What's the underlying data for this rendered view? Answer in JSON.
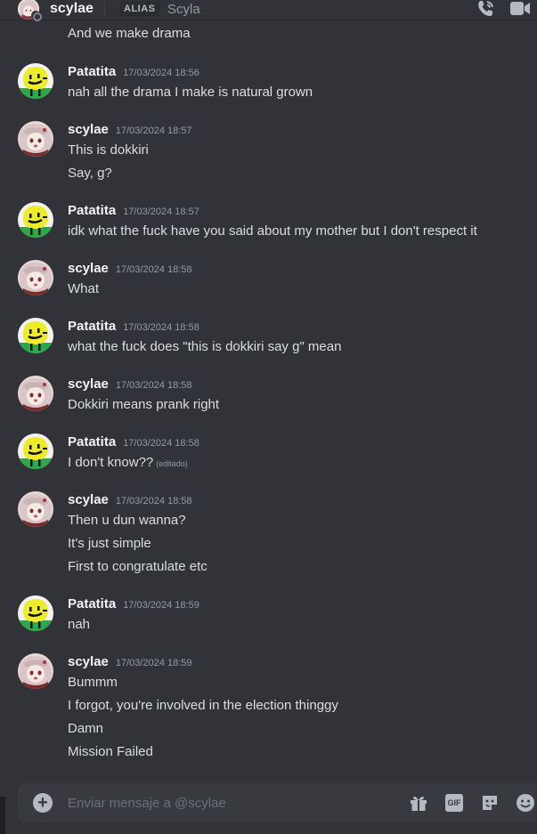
{
  "header": {
    "username": "scylae",
    "alias_badge": "ALIAS",
    "nickname": "Scyla"
  },
  "top_partial_message": "And we make drama",
  "groups": [
    {
      "author": "Patatita",
      "timestamp": "17/03/2024 18:56",
      "avatar": "patatita",
      "lines": [
        "nah all the drama I make is natural grown"
      ]
    },
    {
      "author": "scylae",
      "timestamp": "17/03/2024 18:57",
      "avatar": "scylae",
      "lines": [
        "This is dokkiri",
        "Say, g?"
      ]
    },
    {
      "author": "Patatita",
      "timestamp": "17/03/2024 18:57",
      "avatar": "patatita",
      "lines": [
        "idk what the fuck have you said about my mother but I don't respect it"
      ]
    },
    {
      "author": "scylae",
      "timestamp": "17/03/2024 18:58",
      "avatar": "scylae",
      "lines": [
        "What"
      ]
    },
    {
      "author": "Patatita",
      "timestamp": "17/03/2024 18:58",
      "avatar": "patatita",
      "lines": [
        "what the fuck does \"this is dokkiri say g\" mean"
      ]
    },
    {
      "author": "scylae",
      "timestamp": "17/03/2024 18:58",
      "avatar": "scylae",
      "lines": [
        "Dokkiri means prank right"
      ]
    },
    {
      "author": "Patatita",
      "timestamp": "17/03/2024 18:58",
      "avatar": "patatita",
      "lines": [
        "I don't know??"
      ],
      "edited_label": "(editado)"
    },
    {
      "author": "scylae",
      "timestamp": "17/03/2024 18:58",
      "avatar": "scylae",
      "lines": [
        "Then u dun wanna?",
        "It's just simple",
        "First to congratulate etc"
      ]
    },
    {
      "author": "Patatita",
      "timestamp": "17/03/2024 18:59",
      "avatar": "patatita",
      "lines": [
        "nah"
      ]
    },
    {
      "author": "scylae",
      "timestamp": "17/03/2024 18:59",
      "avatar": "scylae",
      "lines": [
        "Bummm",
        "I forgot, you're involved in the election thinggy",
        "Damn",
        "Mission Failed"
      ]
    }
  ],
  "composer": {
    "placeholder": "Enviar mensaje a @scylae",
    "gif_label": "GIF"
  },
  "icons": {
    "header_call": "phone-call-icon",
    "header_video": "video-camera-icon",
    "composer_add": "plus-circle-icon",
    "composer_gift": "gift-icon",
    "composer_gif": "gif-icon",
    "composer_sticker": "sticker-icon",
    "composer_emoji": "emoji-icon"
  }
}
